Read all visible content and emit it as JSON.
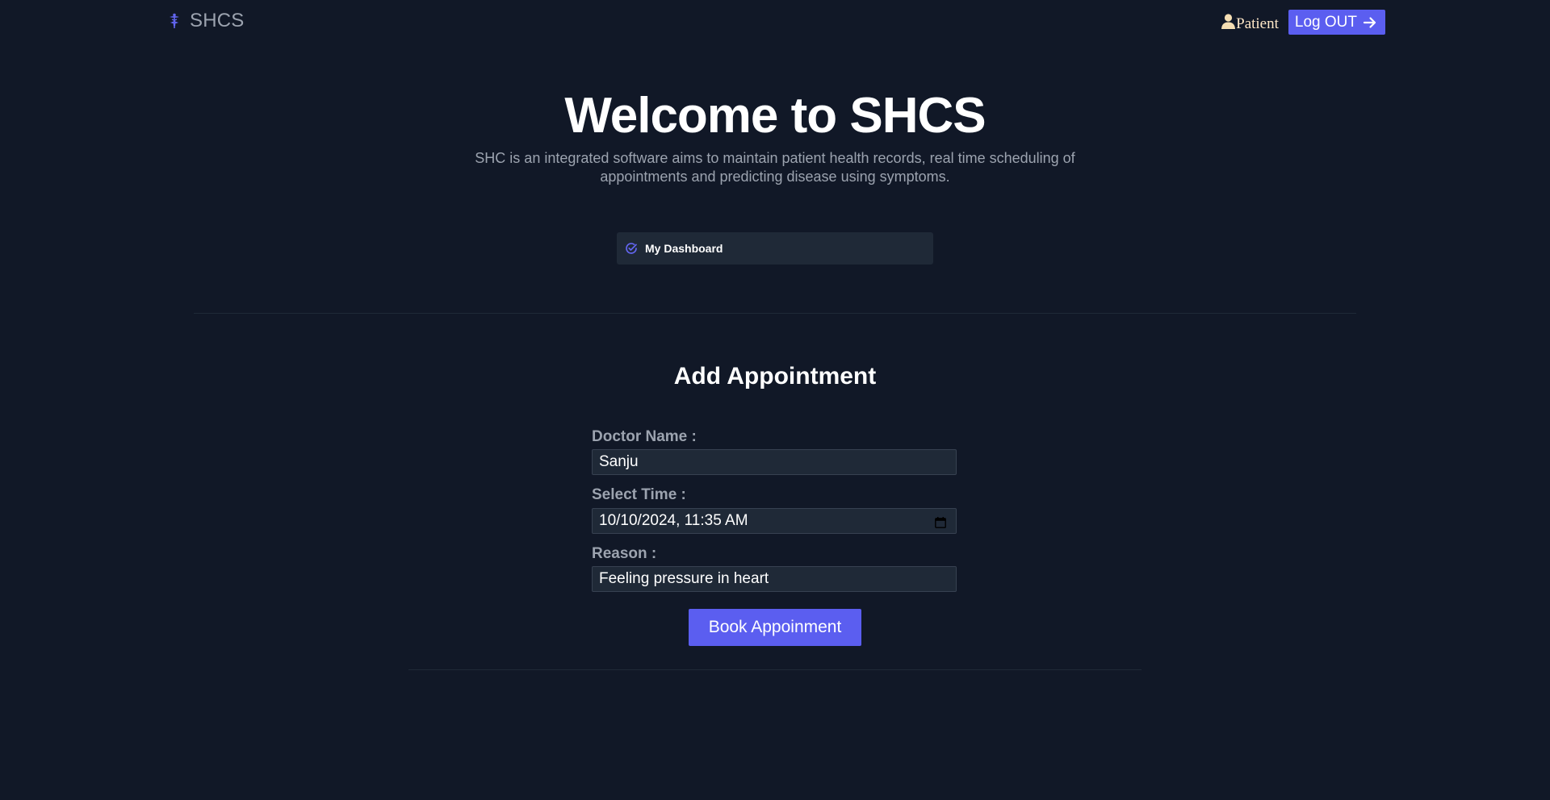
{
  "header": {
    "brand": "SHCS",
    "user_role": "Patient",
    "logout_label": "Log OUT"
  },
  "hero": {
    "title": "Welcome to SHCS",
    "subtitle": "SHC is an integrated software aims to maintain patient health records, real time scheduling of appointments and predicting disease using symptoms."
  },
  "dashboard": {
    "label": "My Dashboard"
  },
  "form": {
    "title": "Add Appointment",
    "doctor_label": "Doctor Name :",
    "doctor_value": "Sanju",
    "time_label": "Select Time :",
    "time_value": "10/10/2024, 11:35 AM",
    "reason_label": "Reason :",
    "reason_value": "Feeling pressure in heart",
    "submit_label": "Book Appoinment"
  },
  "icons": {
    "brand": "caduceus-icon",
    "user": "user-icon",
    "logout": "arrow-right-icon",
    "dashboard": "check-circle-icon",
    "calendar": "calendar-icon"
  },
  "colors": {
    "background": "#111827",
    "accent": "#5b5ef0",
    "muted_text": "#9ca3af",
    "panel": "#1f2937"
  }
}
